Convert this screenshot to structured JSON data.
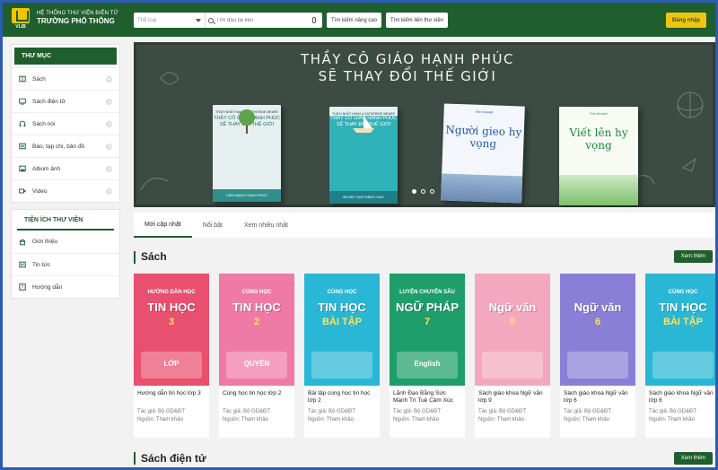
{
  "header": {
    "brand_sub": "HỆ THỐNG THƯ VIỆN ĐIỆN TỬ",
    "brand_main": "TRƯỜNG PHỔ THÔNG",
    "logo_text": "VLIB",
    "category_placeholder": "Thể loại",
    "search_placeholder": "Tìm đầu tài liệu",
    "advanced_search": "Tìm kiếm nâng cao",
    "library_search": "Tìm kiếm liên thư viện",
    "login": "Đăng nhập"
  },
  "sidebar": {
    "directory_title": "THƯ MỤC",
    "directory_items": [
      {
        "label": "Sách"
      },
      {
        "label": "Sách điện tử"
      },
      {
        "label": "Sách nói"
      },
      {
        "label": "Báo, tạp chí, bản đồ"
      },
      {
        "label": "Album ảnh"
      },
      {
        "label": "Video"
      }
    ],
    "utilities_title": "TIỆN ÍCH THƯ VIỆN",
    "utility_items": [
      {
        "label": "Giới thiệu"
      },
      {
        "label": "Tin tức"
      },
      {
        "label": "Hướng dẫn"
      }
    ]
  },
  "banner": {
    "title_line1": "THẦY CÔ GIÁO HẠNH PHÚC",
    "title_line2": "SẼ THAY ĐỔI THẾ GIỚI",
    "books": [
      {
        "author": "THÍCH NHẤT HẠNH & KATHERINE WEARE",
        "title": "THẦY CÔ GIÁO HẠNH PHÚC SẼ THAY ĐỔI THẾ GIỚI",
        "subtitle": "CẨM NANG HẠNH PHÚC"
      },
      {
        "author": "THÍCH NHẤT HẠNH & KATHERINE WEARE",
        "title": "THẦY CÔ GIÁO HẠNH PHÚC SẼ THAY ĐỔI THẾ GIỚI",
        "subtitle": "BÍ MẬT NHỎ ĐẰNG SAU"
      },
      {
        "author": "Erin Gruwell",
        "title": "Người gieo hy vọng",
        "subtitle": ""
      },
      {
        "author": "Erin Gruwell",
        "title": "Viết lên hy vọng",
        "subtitle": ""
      }
    ]
  },
  "tabs": [
    {
      "label": "Mới cập nhật",
      "active": true
    },
    {
      "label": "Nổi bật",
      "active": false
    },
    {
      "label": "Xem nhiều nhất",
      "active": false
    }
  ],
  "section_books": {
    "title": "Sách",
    "more": "Xem thêm",
    "books": [
      {
        "name": "Hướng dẫn tin học lớp 3",
        "author": "Tác giả: Bộ GD&ĐT",
        "source": "Nguồn: Tham khảo",
        "cover_title": "TIN HỌC",
        "cover_sub": "HƯỚNG DẪN HỌC",
        "cover_num": "3",
        "cover_label": "LỚP",
        "color": "#e94f6e"
      },
      {
        "name": "Cùng học tin học lớp 2",
        "author": "Tác giả: Bộ GD&ĐT",
        "source": "Nguồn: Tham khảo",
        "cover_title": "TIN HỌC",
        "cover_sub": "CÙNG HỌC",
        "cover_num": "2",
        "cover_label": "QUYỂN",
        "color": "#f07aa6"
      },
      {
        "name": "Bài tập cùng học tin học lớp 2",
        "author": "Tác giả: Bộ GD&ĐT",
        "source": "Nguồn: Tham khảo",
        "cover_title": "TIN HỌC",
        "cover_sub": "CÙNG HỌC",
        "cover_num": "BÀI TẬP",
        "cover_label": "",
        "color": "#2ab7d6"
      },
      {
        "name": "Lãnh Đạo Bằng Sức Mạnh Trí Tuệ Cảm Xúc",
        "author": "Tác giả: Bộ GD&ĐT",
        "source": "Nguồn: Tham khảo",
        "cover_title": "NGỮ PHÁP",
        "cover_sub": "LUYỆN CHUYÊN SÂU",
        "cover_num": "7",
        "cover_label": "English",
        "color": "#1e9e6a"
      },
      {
        "name": "Sách giáo khoa Ngữ văn lớp 9",
        "author": "Tác giả: Bộ GD&ĐT",
        "source": "Nguồn: Tham khảo",
        "cover_title": "Ngữ văn",
        "cover_sub": "",
        "cover_num": "9",
        "cover_label": "",
        "color": "#f4a8c0"
      },
      {
        "name": "Sách giáo khoa Ngữ văn lớp 6",
        "author": "Tác giả: Bộ GD&ĐT",
        "source": "Nguồn: Tham khảo",
        "cover_title": "Ngữ văn",
        "cover_sub": "",
        "cover_num": "6",
        "cover_label": "",
        "color": "#8a7fd6"
      },
      {
        "name": "Sách giáo khoa Ngữ văn lớp 6",
        "author": "Tác giả: Bộ GD&ĐT",
        "source": "Nguồn: Tham khảo",
        "cover_title": "TIN HỌC",
        "cover_sub": "CÙNG HỌC",
        "cover_num": "BÀI TẬP",
        "cover_label": "",
        "color": "#2ab7d6"
      }
    ]
  },
  "section_ebooks": {
    "title": "Sách điện tử",
    "more": "Xem thêm"
  },
  "colors": {
    "brand_green": "#1f5e2d",
    "accent_yellow": "#f1c40f"
  }
}
